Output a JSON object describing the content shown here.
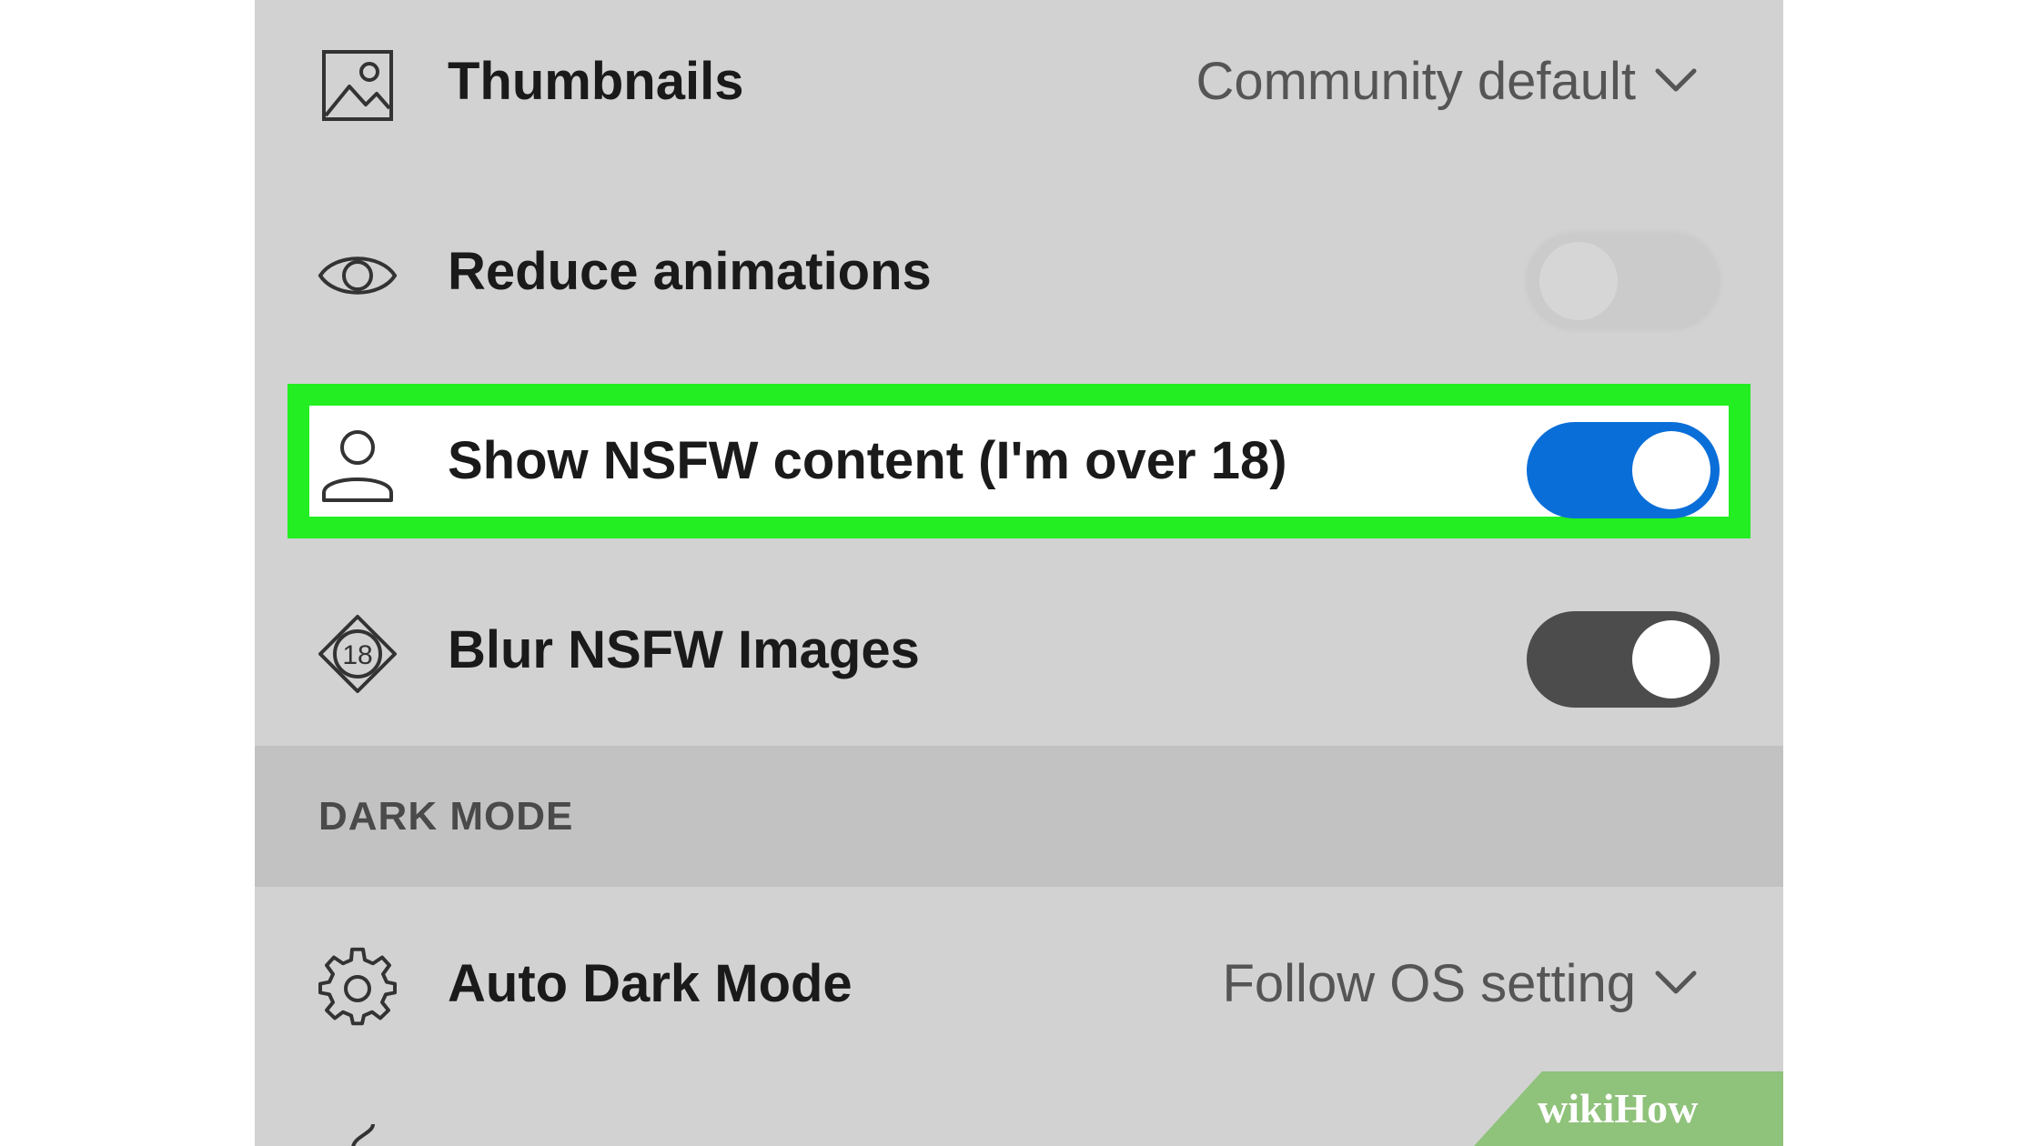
{
  "settings": {
    "thumbnails": {
      "label": "Thumbnails",
      "value": "Community default",
      "icon": "image-icon"
    },
    "reduce_animations": {
      "label": "Reduce animations",
      "icon": "eye-icon",
      "enabled": false
    },
    "show_nsfw": {
      "label": "Show NSFW content (I'm over 18)",
      "icon": "person-icon",
      "enabled": true,
      "highlighted": true
    },
    "blur_nsfw": {
      "label": "Blur NSFW Images",
      "icon": "eighteen-icon",
      "enabled": true
    }
  },
  "dark_mode_section": {
    "title": "DARK MODE",
    "auto_dark_mode": {
      "label": "Auto Dark Mode",
      "value": "Follow OS setting",
      "icon": "gear-icon"
    }
  },
  "watermark": {
    "text": "wikiHow"
  },
  "colors": {
    "panel_background": "#d2d2d2",
    "section_background": "#c2c2c2",
    "toggle_on_blue": "#0a6ed8",
    "toggle_on_dark": "#4c4c4c",
    "highlight_border": "#22ee22",
    "watermark_green": "#8fc27a"
  }
}
